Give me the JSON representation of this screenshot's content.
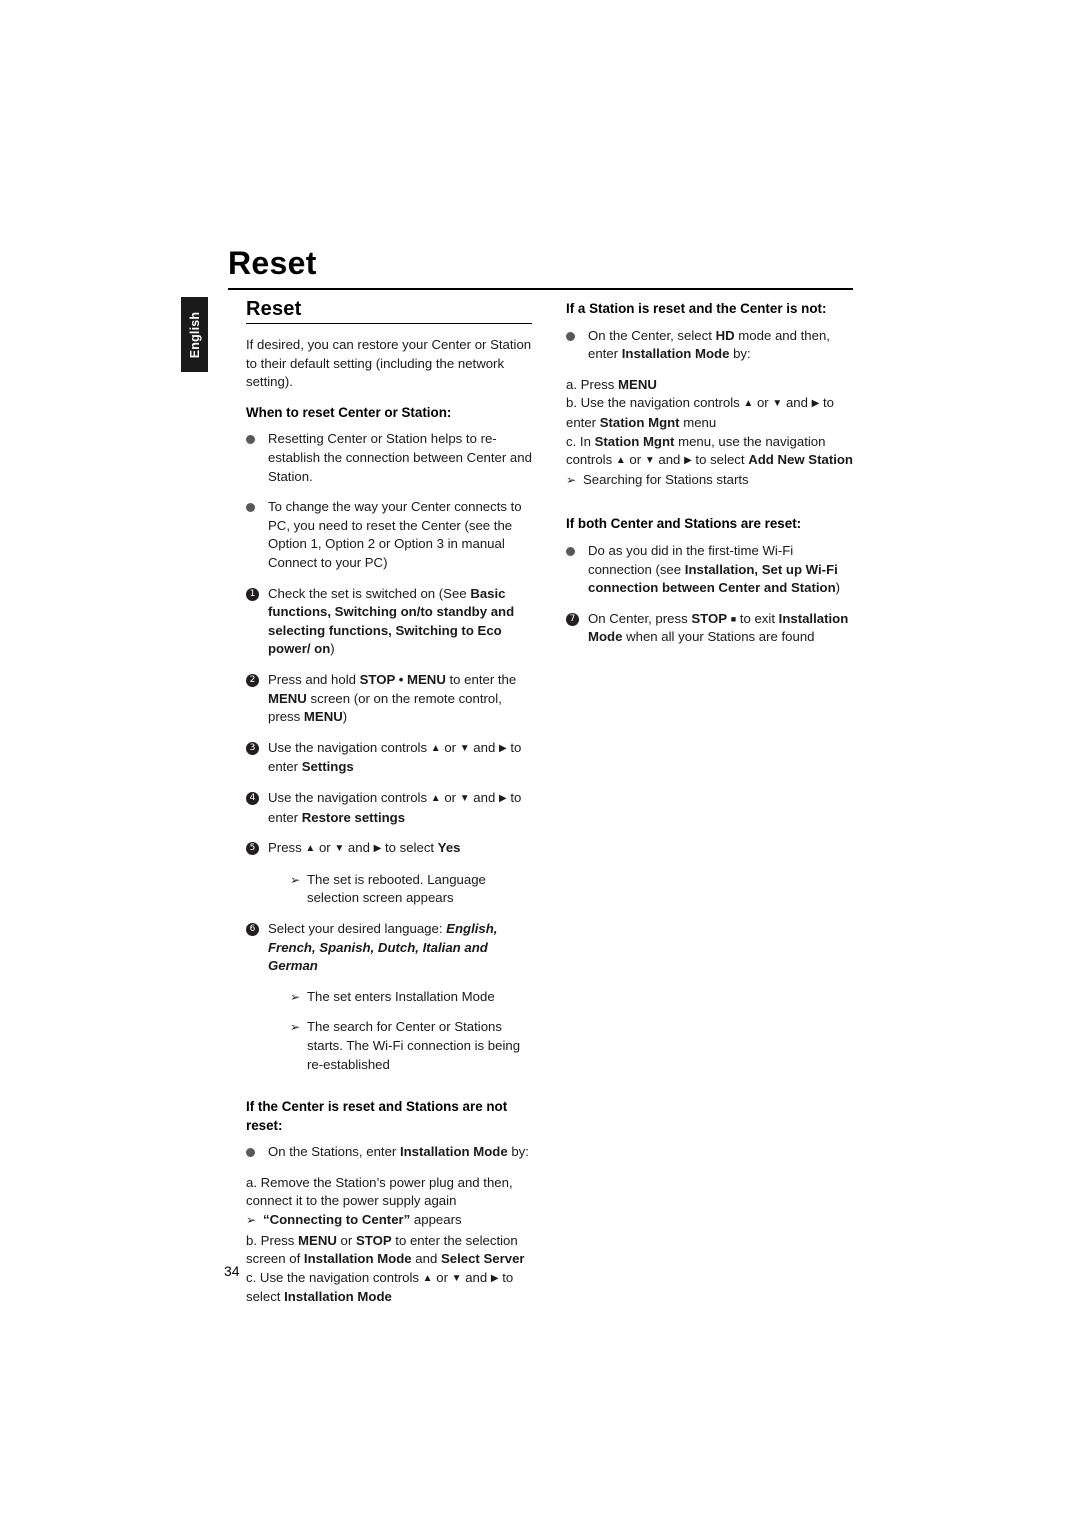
{
  "page": {
    "title": "Reset",
    "language_tab": "English",
    "page_number": "34"
  },
  "left": {
    "section_heading": "Reset",
    "intro": "If desired, you can restore your Center or Station to their default setting (including the network setting).",
    "subhead_when": "When to reset Center or Station:",
    "bullet1": "Resetting Center or Station helps to re-establish the connection between Center and Station.",
    "bullet2": "To change the way your Center connects to PC, you need to reset the Center (see the Option 1, Option 2 or Option 3 in manual Connect to your PC)",
    "step1_num": "1",
    "step1_pre": "Check the set is switched on (See ",
    "step1_bold": "Basic functions, Switching on/to standby and selecting functions, Switching to Eco power/ on",
    "step1_post": ")",
    "step2_num": "2",
    "step2_pre": "Press and hold ",
    "step2_bold1": "STOP • MENU",
    "step2_mid": " to enter the ",
    "step2_bold2": "MENU",
    "step2_mid2": " screen (or on the remote control, press ",
    "step2_bold3": "MENU",
    "step2_post": ")",
    "step3_num": "3",
    "step3_pre": "Use the navigation controls ",
    "step3_mid": " or ",
    "step3_mid2": " and ",
    "step3_post": " to enter ",
    "step3_bold": "Settings",
    "step4_num": "4",
    "step4_pre": "Use the navigation controls ",
    "step4_mid": " or ",
    "step4_mid2": " and ",
    "step4_post": " to enter ",
    "step4_bold": "Restore settings",
    "step5_num": "5",
    "step5_pre": "Press ",
    "step5_mid": " or ",
    "step5_mid2": " and ",
    "step5_post": " to select ",
    "step5_bold": "Yes",
    "step5_result": "The set is rebooted. Language selection screen appears",
    "step6_num": "6",
    "step6_pre": "Select your desired language: ",
    "step6_bolditalic": "English, French, Spanish, Dutch, Italian and German",
    "step6_result1": "The set enters Installation Mode",
    "step6_result2": "The search for Center or Stations starts. The Wi-Fi connection is being re-established",
    "subhead_center_reset": "If the Center is reset and Stations are not reset:",
    "cr_bullet_pre": "On the Stations, enter ",
    "cr_bullet_bold": "Installation Mode",
    "cr_bullet_post": " by:",
    "cr_a": "a. Remove the Station’s power plug and then, connect it to the power supply again",
    "cr_a_result_bold": "“Connecting to Center”",
    "cr_a_result_post": " appears",
    "cr_b_pre": "b. Press ",
    "cr_b_bold1": "MENU",
    "cr_b_mid": " or ",
    "cr_b_bold2": "STOP",
    "cr_b_mid2": " to enter the selection screen of ",
    "cr_b_bold3": "Installation Mode",
    "cr_b_mid3": " and ",
    "cr_b_bold4": "Select Server",
    "cr_c_pre": "c. Use the navigation controls ",
    "cr_c_mid": " or ",
    "cr_c_mid2": " and ",
    "cr_c_post": " to select ",
    "cr_c_bold": "Installation Mode"
  },
  "right": {
    "subhead_station_reset": "If a Station is reset and the Center is not:",
    "sr_bullet_pre": "On the Center, select ",
    "sr_bullet_bold1": "HD",
    "sr_bullet_mid": " mode and then, enter ",
    "sr_bullet_bold2": "Installation Mode",
    "sr_bullet_post": " by:",
    "sr_a_pre": "a. Press ",
    "sr_a_bold": "MENU",
    "sr_b_pre": "b. Use the navigation controls ",
    "sr_b_mid": " or ",
    "sr_b_mid2": " and ",
    "sr_b_post": " to enter ",
    "sr_b_bold": "Station Mgnt",
    "sr_b_end": " menu",
    "sr_c_pre": "c.  In ",
    "sr_c_bold1": "Station Mgnt",
    "sr_c_mid": " menu,  use the navigation controls ",
    "sr_c_mid2": " or ",
    "sr_c_mid3": " and ",
    "sr_c_post": " to select ",
    "sr_c_bold2": "Add New Station",
    "sr_result": "Searching for Stations starts",
    "subhead_both_reset": "If both Center and Stations are reset:",
    "br_bullet_pre": "Do as you did in the first-time Wi-Fi connection (see ",
    "br_bullet_bold": "Installation, Set up Wi-Fi connection between Center and Station",
    "br_bullet_post": ")",
    "step7_num": "7",
    "step7_pre": "On Center, press ",
    "step7_bold1": "STOP",
    "step7_mid": " to exit ",
    "step7_bold2": "Installation Mode",
    "step7_post": " when all your Stations are found"
  }
}
